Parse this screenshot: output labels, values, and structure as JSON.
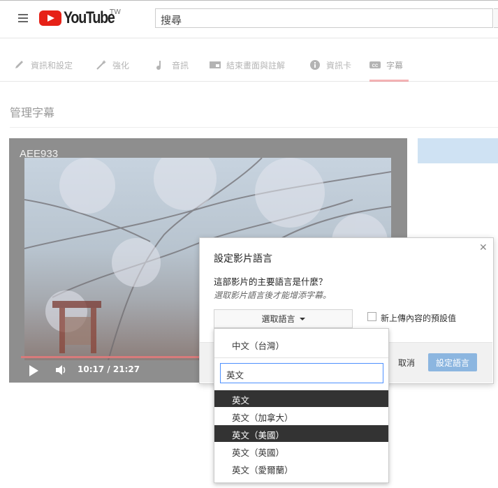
{
  "header": {
    "logo_text": "YouTube",
    "logo_region": "TW",
    "search_value": "搜尋"
  },
  "tabs": [
    {
      "label": "資訊和設定",
      "icon": "pencil-icon"
    },
    {
      "label": "強化",
      "icon": "magic-wand-icon"
    },
    {
      "label": "音訊",
      "icon": "music-note-icon"
    },
    {
      "label": "結束畫面與註解",
      "icon": "end-screen-icon"
    },
    {
      "label": "資訊卡",
      "icon": "info-icon"
    },
    {
      "label": "字幕",
      "icon": "cc-icon",
      "active": true
    }
  ],
  "page_title": "管理字幕",
  "video": {
    "title": "AEE933",
    "time": "10:17 / 21:27",
    "progress": 0.48
  },
  "dialog": {
    "title": "設定影片語言",
    "question": "這部影片的主要語言是什麼？",
    "hint": "選取影片語言後才能增添字幕。",
    "select_label": "選取語言",
    "default_label": "新上傳內容的預設值",
    "cancel_label": "取消",
    "submit_label": "設定語言"
  },
  "dropdown": {
    "current": "中文（台灣）",
    "search_value": "英文",
    "items": [
      {
        "label": "英文",
        "selected": true
      },
      {
        "label": "英文（加拿大）",
        "selected": false
      },
      {
        "label": "英文（美國）",
        "selected": true
      },
      {
        "label": "英文（英國）",
        "selected": false
      },
      {
        "label": "英文（愛爾蘭）",
        "selected": false
      }
    ]
  },
  "colors": {
    "brand_red": "#e62117",
    "primary_button": "#8cb6e0",
    "focus_border": "#4d90fe"
  }
}
